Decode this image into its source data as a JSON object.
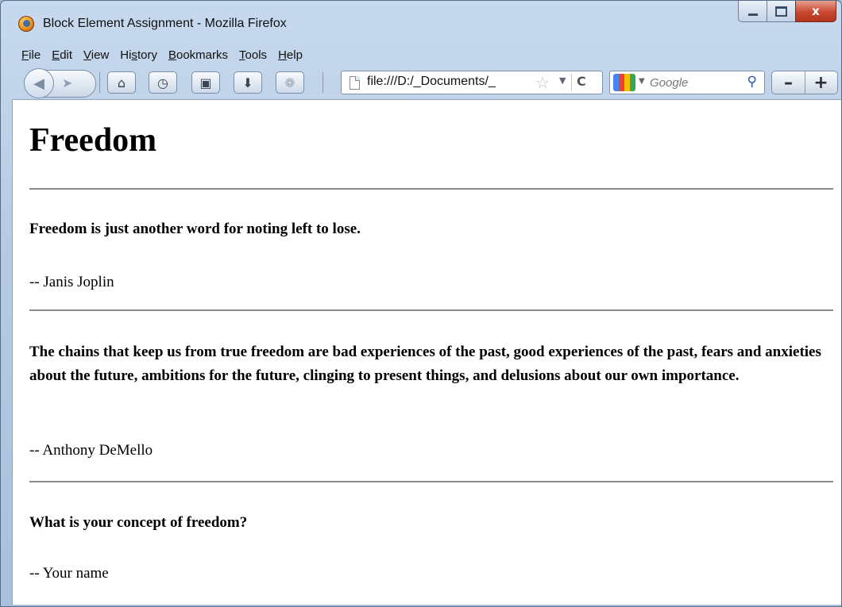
{
  "window": {
    "title": "Block Element Assignment - Mozilla Firefox",
    "minimize_icon": "minimize-icon",
    "maximize_icon": "maximize-icon",
    "close_label": "x"
  },
  "menu": [
    {
      "pre": "",
      "ul": "F",
      "post": "ile"
    },
    {
      "pre": "",
      "ul": "E",
      "post": "dit"
    },
    {
      "pre": "",
      "ul": "V",
      "post": "iew"
    },
    {
      "pre": "Hi",
      "ul": "s",
      "post": "tory"
    },
    {
      "pre": "",
      "ul": "B",
      "post": "ookmarks"
    },
    {
      "pre": "",
      "ul": "T",
      "post": "ools"
    },
    {
      "pre": "",
      "ul": "H",
      "post": "elp"
    }
  ],
  "toolbar": {
    "url": "file:///D:/_Documents/_",
    "search_placeholder": "Google"
  },
  "page": {
    "heading": "Freedom",
    "quotes": [
      {
        "text": "Freedom is just another word for noting left to lose.",
        "author": "-- Janis Joplin"
      },
      {
        "text": "The chains that keep us from true freedom are bad experiences of the past, good experiences of the past, fears and anxieties about the future, ambitions for the future, clinging to present things, and delusions about our own importance.",
        "author": "-- Anthony DeMello"
      },
      {
        "text": "What is your concept of freedom?",
        "author": "-- Your name"
      }
    ]
  },
  "colors": {
    "frame": "#b6cbe3",
    "close": "#c9472f",
    "rule": "#8a8a8a"
  }
}
